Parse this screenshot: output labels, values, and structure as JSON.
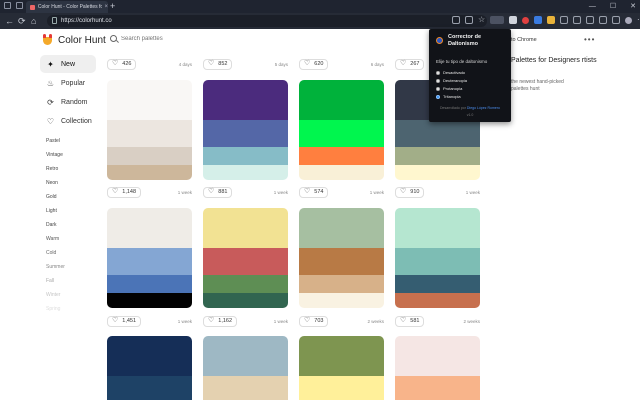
{
  "browser": {
    "tab_title": "Color Hunt - Color Palettes for De",
    "tab_close": "×",
    "new_tab": "+",
    "url": "https://colorhunt.co",
    "win_minimize": "—",
    "win_maximize": "☐",
    "win_close": "✕"
  },
  "site": {
    "logo_text": "Color Hunt",
    "search_placeholder": "Search palettes",
    "more": "•••"
  },
  "sidebar": {
    "items": [
      {
        "label": "New",
        "icon": "sparkle-icon",
        "glyph": "✦",
        "active": true
      },
      {
        "label": "Popular",
        "icon": "flame-icon",
        "glyph": "♨",
        "active": false
      },
      {
        "label": "Random",
        "icon": "random-icon",
        "glyph": "⟳",
        "active": false
      },
      {
        "label": "Collection",
        "icon": "heart-icon",
        "glyph": "♡",
        "active": false
      }
    ],
    "tags": [
      "Pastel",
      "Vintage",
      "Retro",
      "Neon",
      "Gold",
      "Light",
      "Dark",
      "Warm",
      "Cold",
      "Summer",
      "Fall",
      "Winter",
      "Spring"
    ]
  },
  "cards": [
    {
      "likes": "426",
      "age": "4 days",
      "colors": []
    },
    {
      "likes": "852",
      "age": "5 days",
      "colors": []
    },
    {
      "likes": "620",
      "age": "6 days",
      "colors": []
    },
    {
      "likes": "267",
      "age": "",
      "colors": []
    },
    {
      "likes": "1,148",
      "age": "1 week",
      "colors": [
        "#f9f7f5",
        "#ece6e0",
        "#d9cfc4",
        "#cdb79b"
      ]
    },
    {
      "likes": "881",
      "age": "1 week",
      "colors": [
        "#4b2b7d",
        "#5467a7",
        "#86bcc7",
        "#d5efe9"
      ]
    },
    {
      "likes": "574",
      "age": "1 week",
      "colors": [
        "#00b23b",
        "#00f64e",
        "#ff7f3f",
        "#f9f0d7"
      ]
    },
    {
      "likes": "910",
      "age": "1 week",
      "colors": [
        "#313847",
        "#4d6470",
        "#a2ae88",
        "#fff7cf"
      ]
    },
    {
      "likes": "1,451",
      "age": "1 week",
      "colors": [
        "#efece7",
        "#84a6d3",
        "#4b74b7",
        "#020202"
      ]
    },
    {
      "likes": "1,162",
      "age": "1 week",
      "colors": [
        "#f2e293",
        "#c85b5b",
        "#5e8e54",
        "#316550"
      ]
    },
    {
      "likes": "703",
      "age": "2 weeks",
      "colors": [
        "#a6bfa1",
        "#b87a45",
        "#d7b189",
        "#f9f2e2"
      ]
    },
    {
      "likes": "581",
      "age": "2 weeks",
      "colors": [
        "#b5e6d0",
        "#7dbdb4",
        "#355d71",
        "#c7704e"
      ]
    },
    {
      "likes": "",
      "age": "",
      "colors": [
        "#152e57",
        "#1e4266"
      ]
    },
    {
      "likes": "",
      "age": "",
      "colors": [
        "#9eb8c4",
        "#e4d1b0"
      ]
    },
    {
      "likes": "",
      "age": "",
      "colors": [
        "#7e9550",
        "#fff09a"
      ]
    },
    {
      "likes": "",
      "age": "",
      "colors": [
        "#f5e6e4",
        "#f8b48a"
      ]
    }
  ],
  "right_panel": {
    "chrome_link": "to Chrome",
    "title": "Palettes for Designers rtists",
    "desc": "the newest hand-picked palettes hunt"
  },
  "popup": {
    "title": "Corrector de Daltonismo",
    "subtitle": "Elije tu tipo de daltonismo",
    "options": [
      {
        "label": "Desactivado",
        "selected": false
      },
      {
        "label": "Deuteranopia",
        "selected": false
      },
      {
        "label": "Protanopia",
        "selected": false
      },
      {
        "label": "Tritanopia",
        "selected": true
      }
    ],
    "footer_prefix": "Desarrollado por",
    "footer_author": "Diego López Romero",
    "version": "v1.0"
  }
}
